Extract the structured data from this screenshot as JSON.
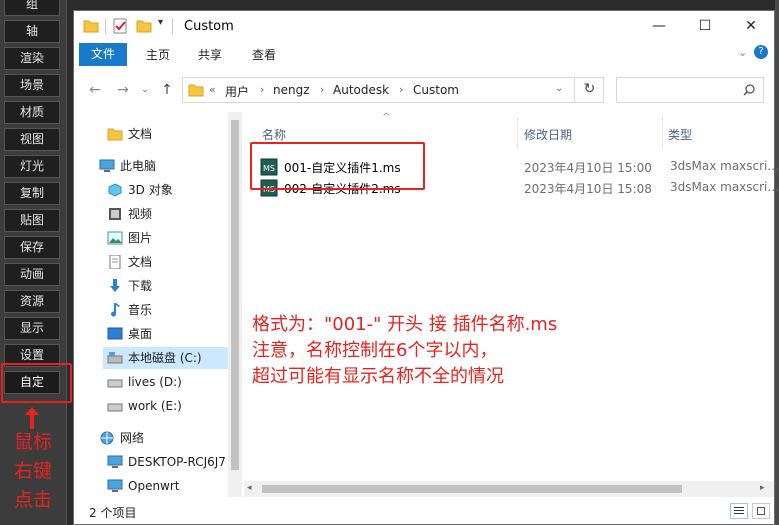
{
  "toolbar": {
    "items": [
      "组",
      "轴",
      "渲染",
      "场景",
      "材质",
      "视图",
      "灯光",
      "复制",
      "贴图",
      "保存",
      "动画",
      "资源",
      "显示",
      "设置",
      "自定"
    ],
    "active_index": 14
  },
  "annotations": {
    "left": "鼠标右键点击",
    "main": "格式为：\"001-\" 开头 接 插件名称.ms\n注意，名称控制在6个字以内，\n超过可能有显示名称不全的情况",
    "color": "#e8231f"
  },
  "window": {
    "title": "Custom",
    "minimize": "—",
    "maximize": "☐",
    "close": "✕",
    "help": "?",
    "collapse": "⌄"
  },
  "ribbon": {
    "tabs": [
      "文件",
      "主页",
      "共享",
      "查看"
    ],
    "active_color": "#1979ca"
  },
  "address": {
    "prefix": "«",
    "crumbs": [
      "用户",
      "nengz",
      "Autodesk",
      "Custom"
    ],
    "search_placeholder": ""
  },
  "nav": {
    "items": [
      {
        "label": "文档",
        "icon": "folder-icon"
      },
      {
        "label": "此电脑",
        "icon": "computer-icon"
      },
      {
        "label": "3D 对象",
        "icon": "cube-icon"
      },
      {
        "label": "视频",
        "icon": "video-icon"
      },
      {
        "label": "图片",
        "icon": "picture-icon"
      },
      {
        "label": "文档",
        "icon": "document-icon"
      },
      {
        "label": "下载",
        "icon": "download-icon"
      },
      {
        "label": "音乐",
        "icon": "music-icon"
      },
      {
        "label": "桌面",
        "icon": "desktop-icon"
      },
      {
        "label": "本地磁盘 (C:)",
        "icon": "drive-c-icon"
      },
      {
        "label": "lives (D:)",
        "icon": "drive-icon"
      },
      {
        "label": "work (E:)",
        "icon": "drive-icon"
      },
      {
        "label": "网络",
        "icon": "network-icon"
      },
      {
        "label": "DESKTOP-RCJ6J7",
        "icon": "network-pc-icon"
      },
      {
        "label": "Openwrt",
        "icon": "network-pc-icon"
      }
    ],
    "selected_index": 9
  },
  "files": {
    "columns": [
      "名称",
      "修改日期",
      "类型"
    ],
    "rows": [
      {
        "name": "001-自定义插件1.ms",
        "date": "2023年4月10日 15:00",
        "type": "3dsMax maxscri..."
      },
      {
        "name": "002-自定义插件2.ms",
        "date": "2023年4月10日 15:08",
        "type": "3dsMax maxscri..."
      }
    ]
  },
  "status": {
    "count": "2 个项目"
  }
}
